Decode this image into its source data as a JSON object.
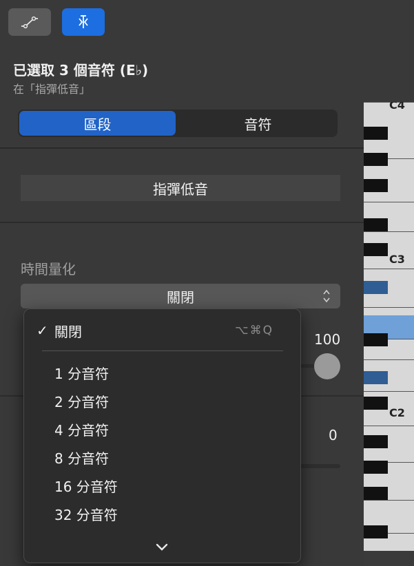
{
  "toolbar": {
    "left_icon": "automation-curve-icon",
    "right_icon": "smart-controls-icon",
    "accent_color": "#1d6ee0"
  },
  "selection": {
    "title": "已選取 3 個音符 (E♭)",
    "subtitle": "在「指彈低音」"
  },
  "segmented": {
    "region_label": "區段",
    "note_label": "音符"
  },
  "region": {
    "name": "指彈低音"
  },
  "quantize": {
    "label": "時間量化",
    "selected_value": "關閉"
  },
  "strength": {
    "value": "100"
  },
  "swing": {
    "value": "0"
  },
  "menu": {
    "items": [
      {
        "label": "關閉",
        "checked": true,
        "shortcut": "⌥⌘Q"
      },
      {
        "label": "1 分音符"
      },
      {
        "label": "2 分音符"
      },
      {
        "label": "4 分音符"
      },
      {
        "label": "8 分音符"
      },
      {
        "label": "16 分音符"
      },
      {
        "label": "32 分音符"
      }
    ],
    "more_icon": "chevron-down-icon"
  },
  "keyboard": {
    "labels": [
      "C4",
      "C3",
      "C2"
    ],
    "highlight_color": "#6fa0d8"
  }
}
